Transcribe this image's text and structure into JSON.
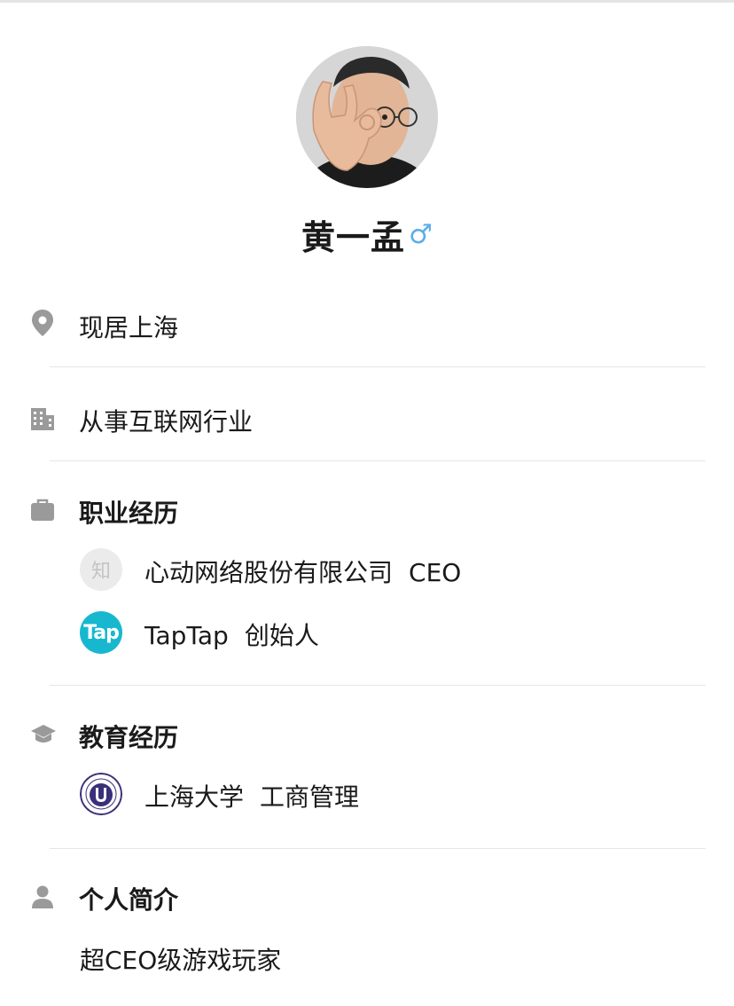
{
  "profile": {
    "name": "黄一孟",
    "gender_symbol": "♂"
  },
  "location": {
    "icon": "location-pin-icon",
    "text": "现居上海"
  },
  "industry": {
    "icon": "building-icon",
    "text": "从事互联网行业"
  },
  "career": {
    "icon": "briefcase-icon",
    "title": "职业经历",
    "items": [
      {
        "logo_text": "知",
        "company": "心动网络股份有限公司",
        "role": "CEO"
      },
      {
        "logo_text": "Tap",
        "company": "TapTap",
        "role": "创始人"
      }
    ]
  },
  "education": {
    "icon": "graduation-cap-icon",
    "title": "教育经历",
    "items": [
      {
        "school": "上海大学",
        "major": "工商管理"
      }
    ]
  },
  "intro": {
    "icon": "person-icon",
    "title": "个人简介",
    "text": "超CEO级游戏玩家"
  },
  "colors": {
    "gender": "#5aaee9",
    "icon_gray": "#9a9a9a",
    "taptap": "#17b8cf"
  }
}
